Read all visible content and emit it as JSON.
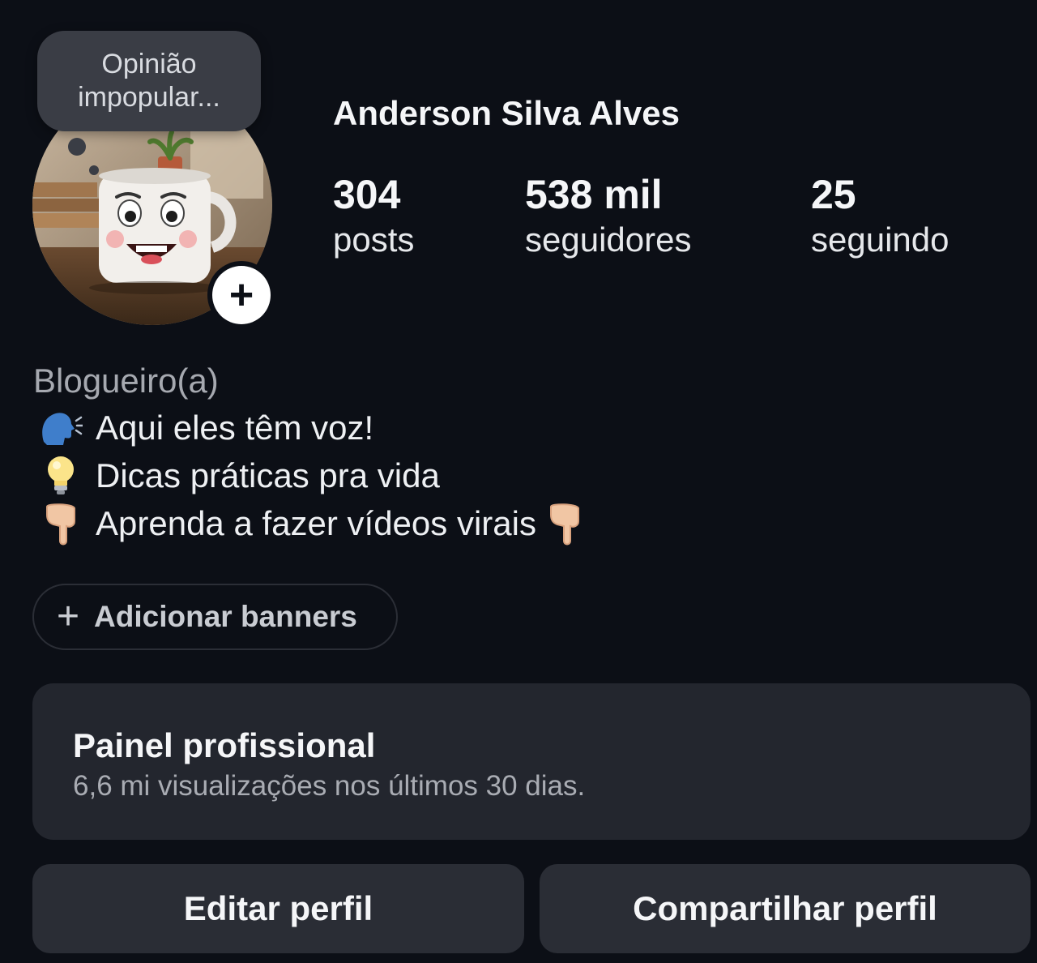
{
  "profile": {
    "name": "Anderson Silva Alves",
    "note_line1": "Opinião",
    "note_line2": "impopular...",
    "add_story_label": "+",
    "avatar_icon": "smiling-mug-avatar"
  },
  "stats": {
    "posts": {
      "value": "304",
      "label": "posts"
    },
    "followers": {
      "value": "538 mil",
      "label": "seguidores"
    },
    "following": {
      "value": "25",
      "label": "seguindo"
    }
  },
  "bio": {
    "category": "Blogueiro(a)",
    "lines": [
      {
        "emoji": "speaking-head-icon",
        "text": "Aqui eles têm voz!"
      },
      {
        "emoji": "light-bulb-icon",
        "text": "Dicas práticas pra vida"
      },
      {
        "emoji": "pointing-down-icon",
        "text": "Aprenda a fazer vídeos virais",
        "trailing_emoji": "pointing-down-icon"
      }
    ]
  },
  "banners": {
    "plus": "+",
    "label": "Adicionar banners"
  },
  "dashboard": {
    "title": "Painel profissional",
    "subtitle": "6,6 mi visualizações nos últimos 30 dias."
  },
  "actions": {
    "edit": "Editar perfil",
    "share": "Compartilhar perfil"
  },
  "colors": {
    "background": "#0c0f16",
    "panel": "#23262e",
    "button": "#2a2d35",
    "muted_text": "#a6a9b0"
  }
}
